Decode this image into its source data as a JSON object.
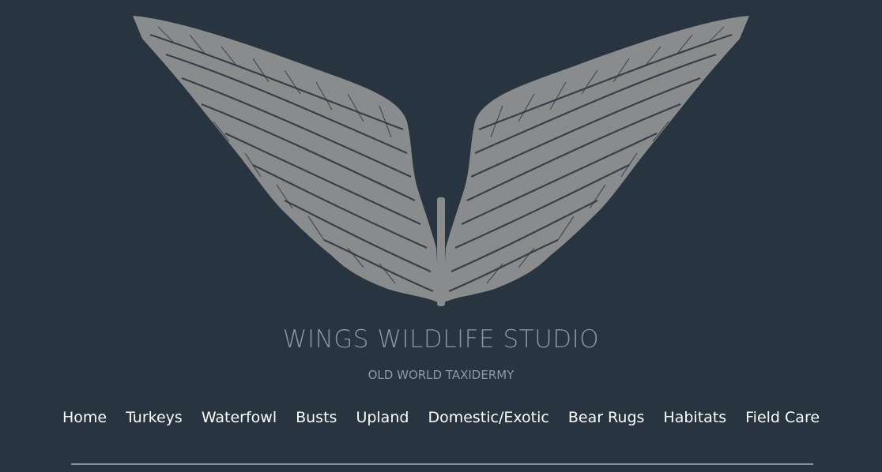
{
  "site": {
    "title": "WINGS WILDLIFE STUDIO",
    "tagline": "OLD WORLD TAXIDERMY"
  },
  "logo": {
    "icon": "wings-logo-icon",
    "color": "#8a8b8d"
  },
  "nav": {
    "items": [
      {
        "label": "Home"
      },
      {
        "label": "Turkeys"
      },
      {
        "label": "Waterfowl"
      },
      {
        "label": "Busts"
      },
      {
        "label": "Upland"
      },
      {
        "label": "Domestic/Exotic"
      },
      {
        "label": "Bear Rugs"
      },
      {
        "label": "Habitats"
      },
      {
        "label": "Field Care"
      }
    ]
  },
  "colors": {
    "background": "#283440",
    "title": "#8b97a6",
    "nav_text": "#ffffff",
    "divider": "#7e93a8"
  }
}
